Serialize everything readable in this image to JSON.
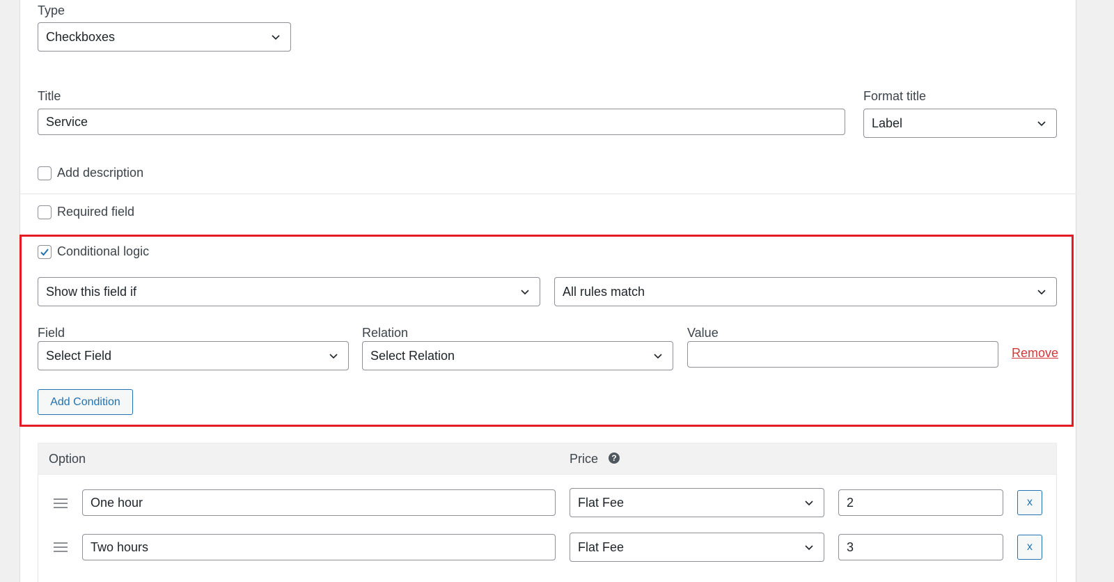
{
  "type_field": {
    "label": "Type",
    "value": "Checkboxes"
  },
  "title_field": {
    "label": "Title",
    "value": "Service"
  },
  "format_title": {
    "label": "Format title",
    "value": "Label"
  },
  "add_description": {
    "label": "Add description",
    "checked": false
  },
  "required_field": {
    "label": "Required field",
    "checked": false
  },
  "conditional_logic": {
    "label": "Conditional logic",
    "checked": true,
    "show_select": "Show this field if",
    "match_select": "All rules match",
    "field_label": "Field",
    "field_select": "Select Field",
    "relation_label": "Relation",
    "relation_select": "Select Relation",
    "value_label": "Value",
    "value_input": "",
    "remove_label": "Remove",
    "add_condition_label": "Add Condition"
  },
  "options_table": {
    "option_header": "Option",
    "price_header": "Price",
    "help_icon": "question-circle-icon",
    "rows": [
      {
        "option": "One hour",
        "price_type": "Flat Fee",
        "price": "2",
        "remove": "x"
      },
      {
        "option": "Two hours",
        "price_type": "Flat Fee",
        "price": "3",
        "remove": "x"
      }
    ]
  },
  "colors": {
    "accent": "#2271b1",
    "highlight_border": "#e41b23",
    "remove_link": "#d63638",
    "checkbox_check": "#2271b1"
  }
}
